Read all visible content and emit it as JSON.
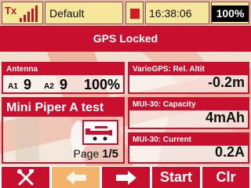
{
  "status": {
    "tx_label": "Tx",
    "model_name": "Default",
    "time": "16:38:06",
    "battery": "100%"
  },
  "title": "GPS Locked",
  "panels": {
    "antenna": {
      "header": "Antenna",
      "a1_label": "A1",
      "a1_value": "9",
      "a2_label": "A2",
      "a2_value": "9",
      "quality": "100%"
    },
    "model": {
      "name": "Mini Piper A test",
      "page_label": "Page",
      "page_value": "1/5"
    },
    "altitude": {
      "header": "VarioGPS: Rel. Altit",
      "value": "-0.2m"
    },
    "capacity": {
      "header": "MUI-30: Capacity",
      "value": "4mAh"
    },
    "current": {
      "header": "MUI-30: Current",
      "value": "0.2A"
    }
  },
  "keys": {
    "k1_icon": "tools-icon",
    "k2_icon": "arrow-left-icon",
    "k3_icon": "arrow-right-icon",
    "k4_label": "Start",
    "k5_label": "Clr"
  },
  "colors": {
    "accent_red": "#c8102e",
    "status_yellow": "#f6e79c",
    "key_disabled": "#f2b46a"
  }
}
